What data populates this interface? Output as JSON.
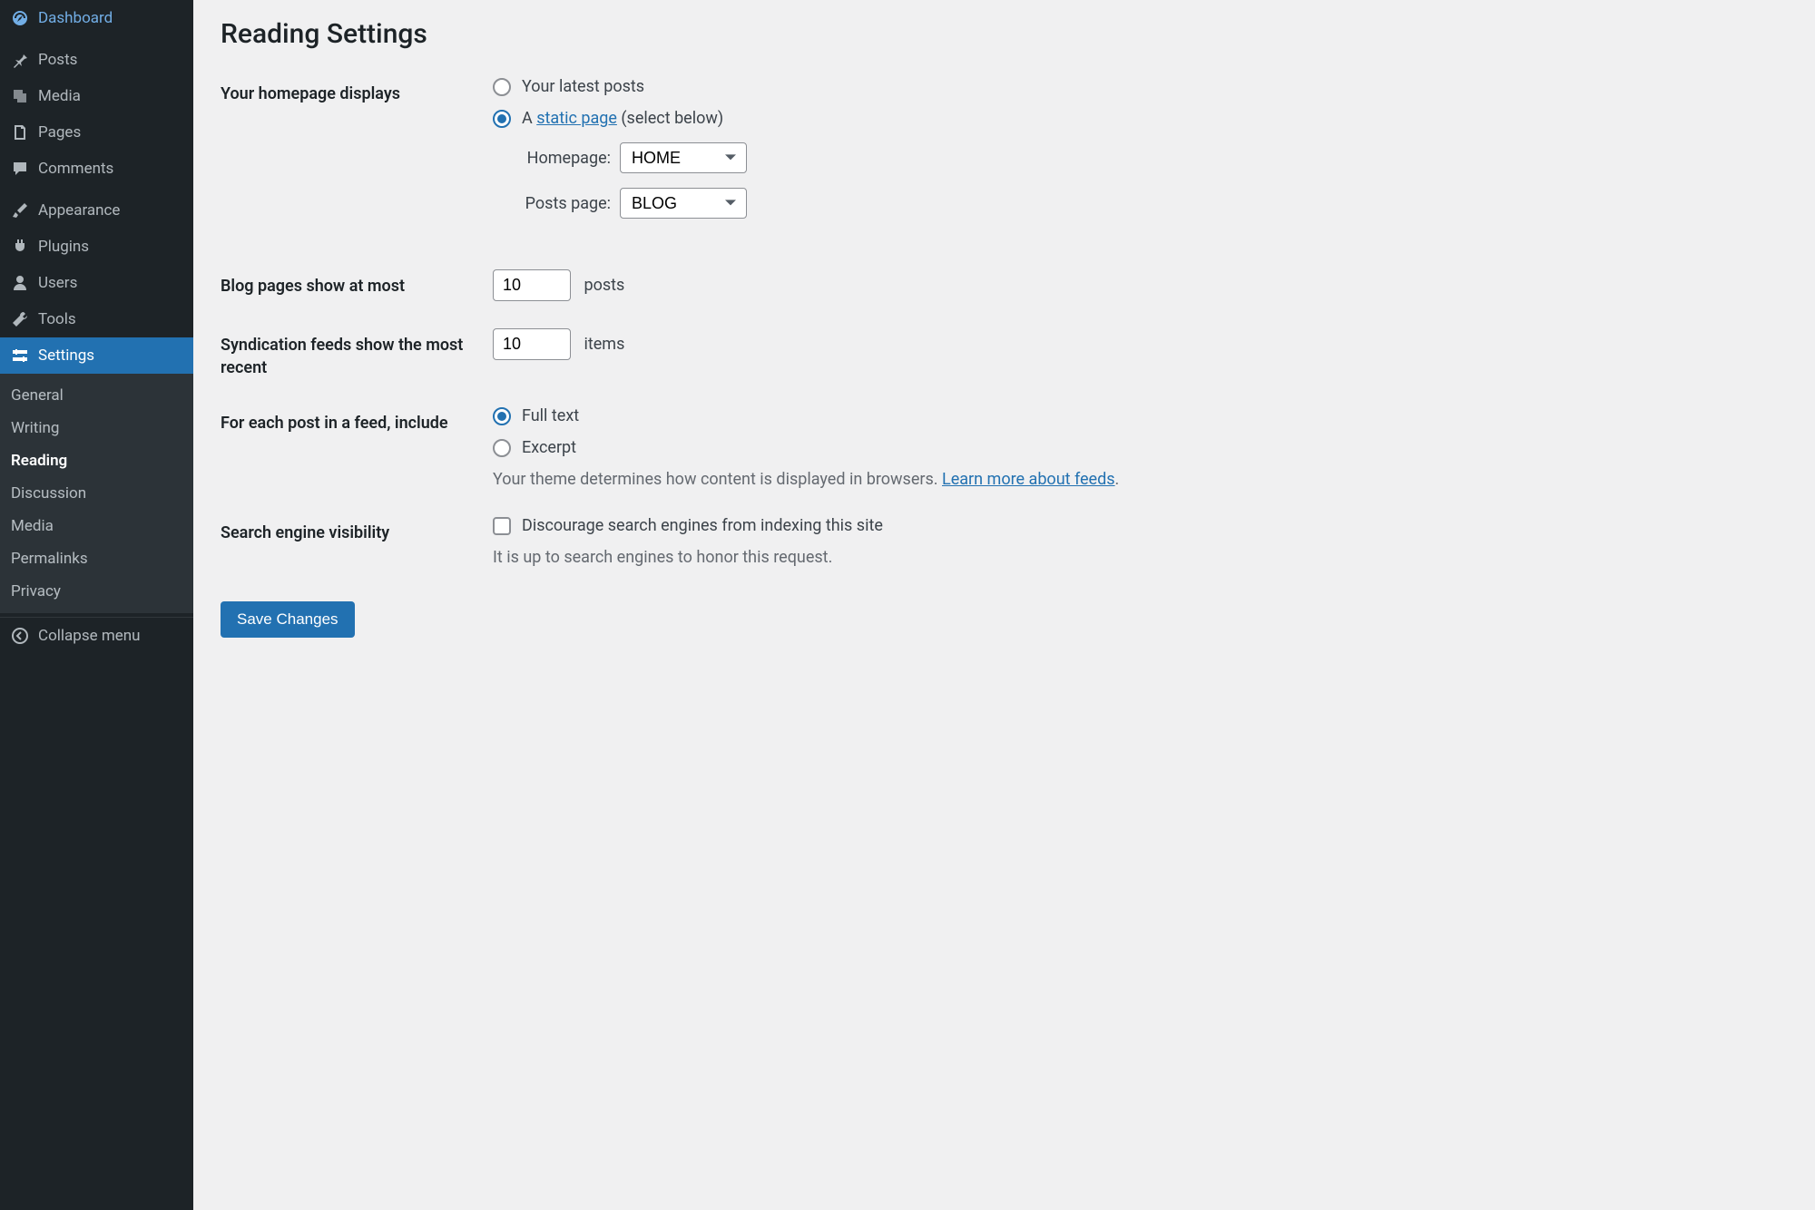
{
  "sidebar": {
    "items": [
      {
        "label": "Dashboard"
      },
      {
        "label": "Posts"
      },
      {
        "label": "Media"
      },
      {
        "label": "Pages"
      },
      {
        "label": "Comments"
      },
      {
        "label": "Appearance"
      },
      {
        "label": "Plugins"
      },
      {
        "label": "Users"
      },
      {
        "label": "Tools"
      },
      {
        "label": "Settings"
      }
    ],
    "submenu": [
      {
        "label": "General"
      },
      {
        "label": "Writing"
      },
      {
        "label": "Reading"
      },
      {
        "label": "Discussion"
      },
      {
        "label": "Media"
      },
      {
        "label": "Permalinks"
      },
      {
        "label": "Privacy"
      }
    ],
    "collapse": "Collapse menu"
  },
  "page": {
    "title": "Reading Settings",
    "homepage_displays": {
      "label": "Your homepage displays",
      "opt_latest": "Your latest posts",
      "opt_static_prefix": "A ",
      "opt_static_link": "static page",
      "opt_static_suffix": " (select below)",
      "homepage_label": "Homepage:",
      "homepage_value": "HOME",
      "postspage_label": "Posts page:",
      "postspage_value": "BLOG"
    },
    "blog_pages": {
      "label": "Blog pages show at most",
      "value": "10",
      "suffix": "posts"
    },
    "syndication": {
      "label": "Syndication feeds show the most recent",
      "value": "10",
      "suffix": "items"
    },
    "feed_include": {
      "label": "For each post in a feed, include",
      "opt_full": "Full text",
      "opt_excerpt": "Excerpt",
      "desc_prefix": "Your theme determines how content is displayed in browsers. ",
      "desc_link": "Learn more about feeds",
      "desc_suffix": "."
    },
    "search_visibility": {
      "label": "Search engine visibility",
      "checkbox_label": "Discourage search engines from indexing this site",
      "desc": "It is up to search engines to honor this request."
    },
    "save_button": "Save Changes"
  }
}
